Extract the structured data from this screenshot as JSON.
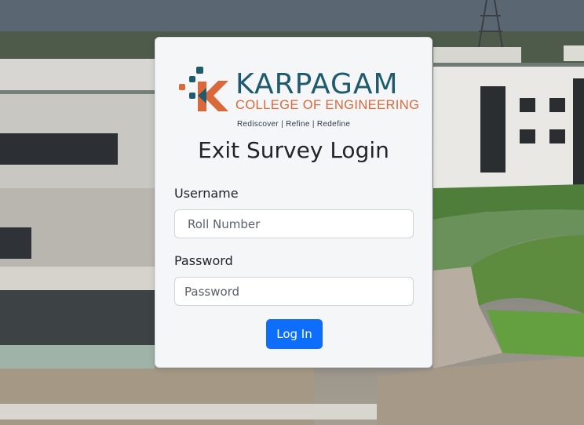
{
  "brand": {
    "name": "KARPAGAM",
    "subtitle": "COLLEGE OF ENGINEERING",
    "tagline": "Rediscover  |  Refine  |  Redefine",
    "colors": {
      "teal": "#1f5a6d",
      "orange": "#d9683b"
    }
  },
  "login": {
    "title": "Exit Survey Login",
    "username_label": "Username",
    "username_placeholder": "Roll Number",
    "password_label": "Password",
    "password_placeholder": "Password",
    "submit_label": "Log In",
    "button_color": "#0d6efd"
  }
}
